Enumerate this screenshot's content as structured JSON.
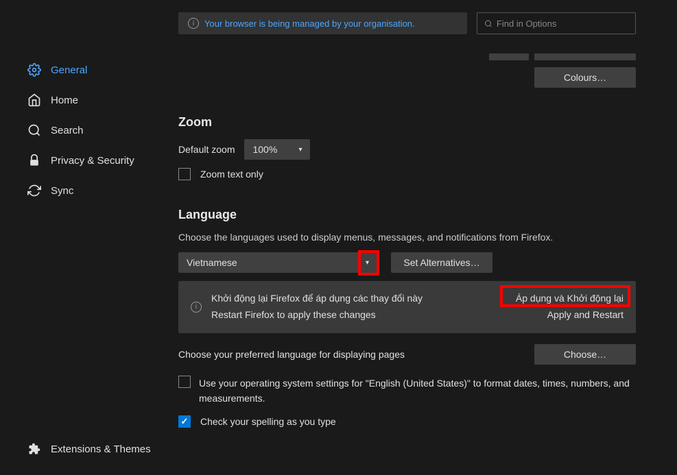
{
  "topbar": {
    "notice": "Your browser is being managed by your organisation.",
    "search_placeholder": "Find in Options"
  },
  "sidebar": {
    "items": [
      {
        "label": "General",
        "icon": "gear"
      },
      {
        "label": "Home",
        "icon": "home"
      },
      {
        "label": "Search",
        "icon": "search"
      },
      {
        "label": "Privacy & Security",
        "icon": "lock"
      },
      {
        "label": "Sync",
        "icon": "sync"
      }
    ],
    "bottom": {
      "label": "Extensions & Themes",
      "icon": "puzzle"
    }
  },
  "buttons": {
    "colours": "Colours…",
    "set_alternatives": "Set Alternatives…",
    "choose": "Choose…"
  },
  "zoom": {
    "title": "Zoom",
    "default_label": "Default zoom",
    "default_value": "100%",
    "text_only": "Zoom text only"
  },
  "language": {
    "title": "Language",
    "description": "Choose the languages used to display menus, messages, and notifications from Firefox.",
    "selected": "Vietnamese",
    "restart_vi": "Khởi động lại Firefox để áp dụng các thay đổi này",
    "restart_en": "Restart Firefox to apply these changes",
    "apply_vi": "Áp dụng và Khởi động lại",
    "apply_en": "Apply and Restart",
    "display_pages": "Choose your preferred language for displaying pages",
    "os_settings": "Use your operating system settings for \"English (United States)\" to format dates, times, numbers, and measurements.",
    "spellcheck": "Check your spelling as you type"
  }
}
